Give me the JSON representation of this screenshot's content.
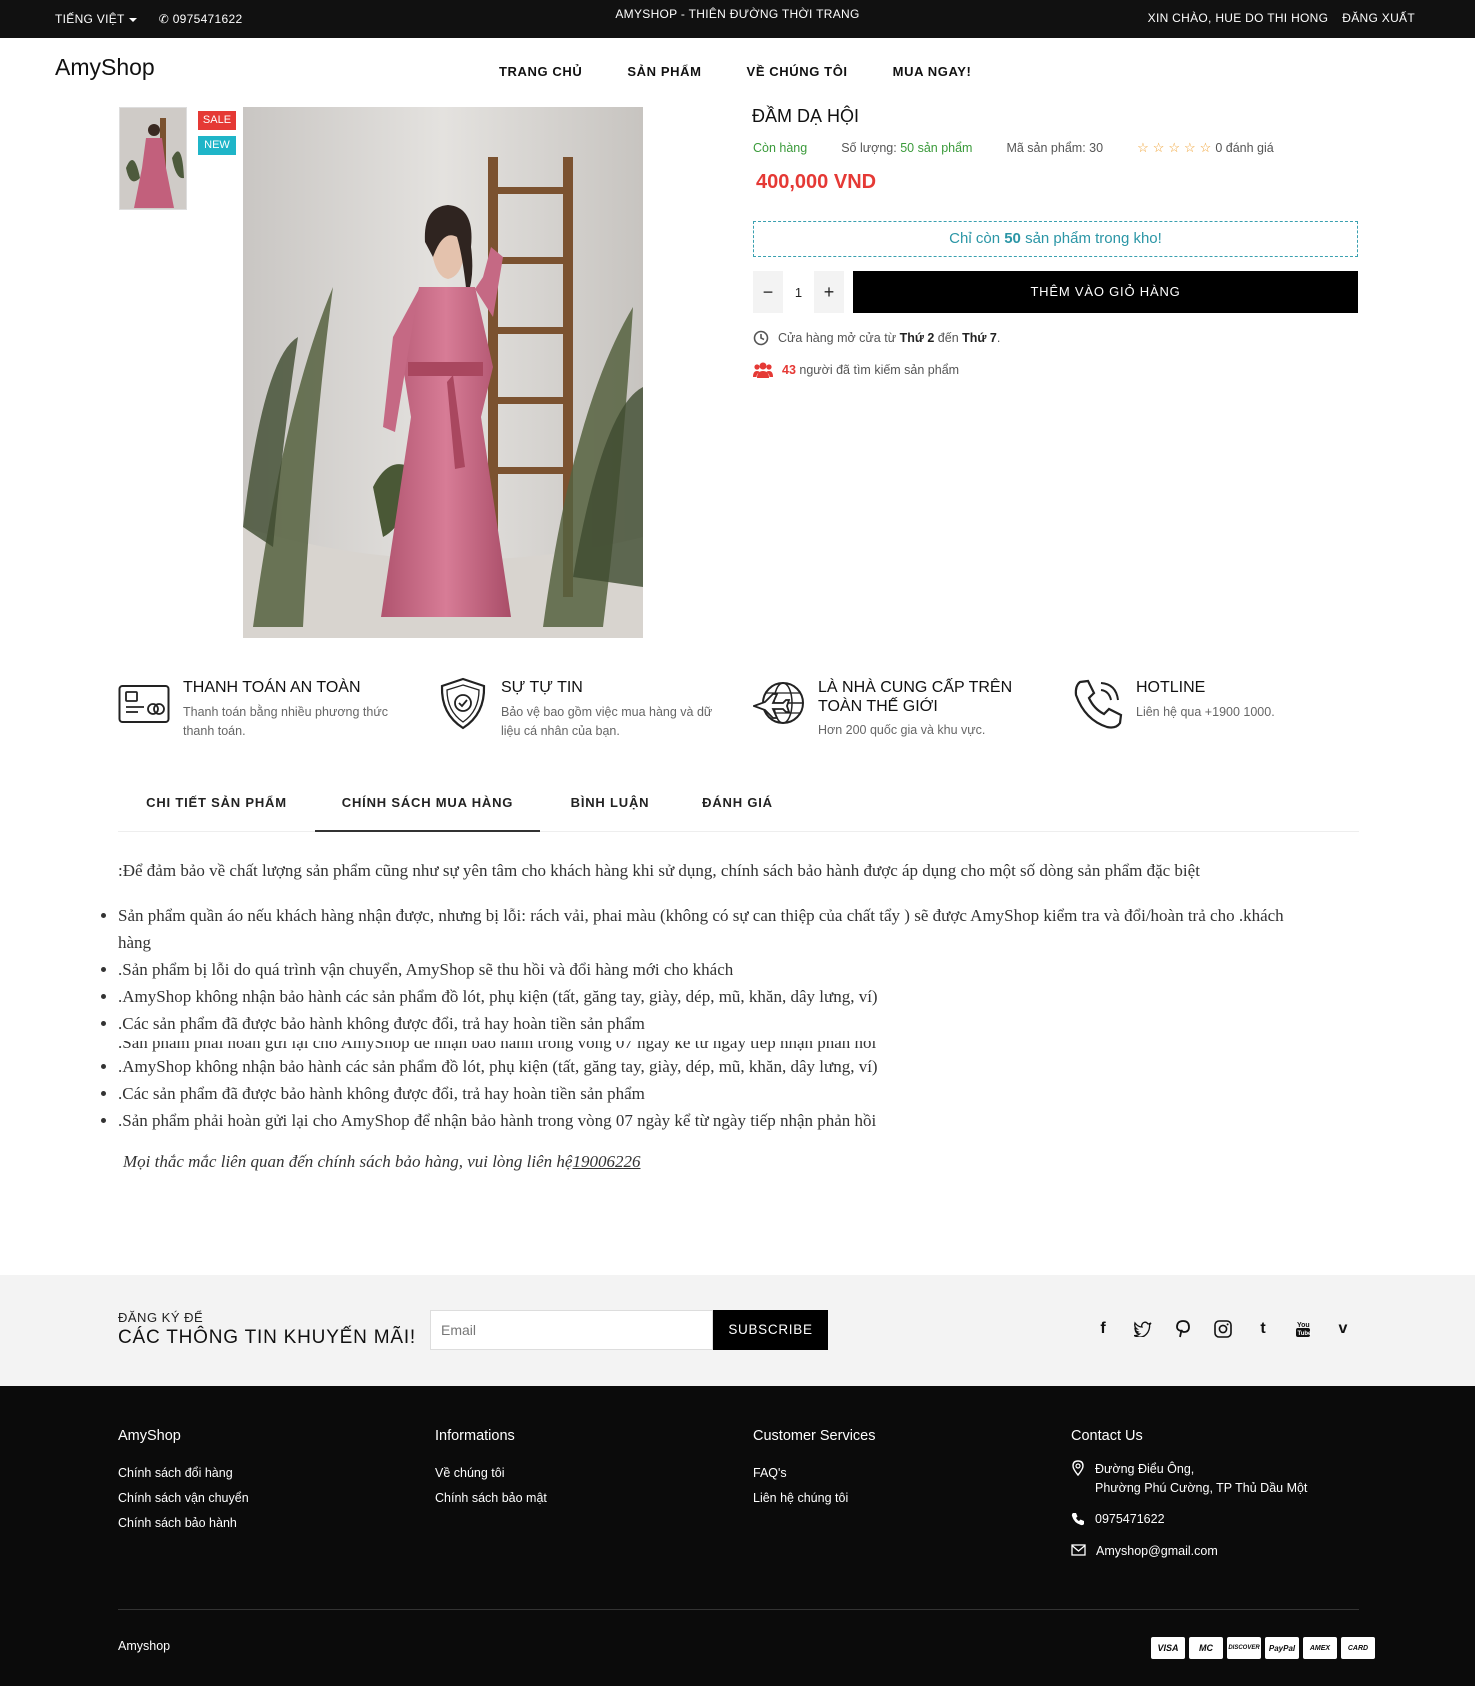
{
  "topbar": {
    "language": "TIẾNG VIỆT",
    "phone": "0975471622",
    "tagline": "AMYSHOP - THIÊN ĐƯỜNG THỜI TRANG",
    "greeting": "XIN CHÀO, HUE DO THI HONG",
    "logout": "ĐĂNG XUẤT"
  },
  "header": {
    "logo": "AmyShop",
    "nav": [
      "TRANG CHỦ",
      "SẢN PHẨM",
      "VỀ CHÚNG TÔI",
      "MUA NGAY!"
    ]
  },
  "gallery": {
    "badges": [
      "SALE",
      "NEW"
    ]
  },
  "product": {
    "title": "ĐẦM DẠ HỘI",
    "status": "Còn hàng",
    "quantity_label": "Số lượng:",
    "quantity_value": "50 sản phẩm",
    "code": "Mã sản phẩm: 30",
    "rating_text": "0 đánh giá",
    "rating_stars": 0,
    "price": "400,000 VND",
    "stock_pre": "Chỉ còn",
    "stock_num": "50",
    "stock_post": "sản phẩm trong kho!",
    "qty_minus": "−",
    "qty_value": "1",
    "qty_plus": "+",
    "add_to_cart": "THÊM VÀO GIỎ HÀNG",
    "hours_pre": "Cửa hàng mở cửa từ",
    "hours_from": "Thứ 2",
    "hours_mid": "đến",
    "hours_to": "Thứ 7",
    "hours_end": ".",
    "viewers_num": "43",
    "viewers_text": "người đã tìm kiếm sản phẩm"
  },
  "features": [
    {
      "title": "THANH TOÁN AN TOÀN",
      "desc": "Thanh toán bằng nhiều phương thức thanh toán.",
      "icon": "credit-card-icon"
    },
    {
      "title": "SỰ TỰ TIN",
      "desc": "Bảo vệ bao gồm việc mua hàng và dữ liệu cá nhân của bạn.",
      "icon": "shield-check-icon"
    },
    {
      "title": "LÀ NHÀ CUNG CẤP TRÊN TOÀN THẾ GIỚI",
      "desc": "Hơn 200 quốc gia và khu vực.",
      "icon": "plane-globe-icon"
    },
    {
      "title": "HOTLINE",
      "desc": "Liên hệ qua +1900 1000.",
      "icon": "phone-icon"
    }
  ],
  "tabs": [
    "CHI TIẾT SẢN PHẨM",
    "CHÍNH SÁCH MUA HÀNG",
    "BÌNH LUẬN",
    "ĐÁNH GIÁ"
  ],
  "active_tab": "CHÍNH SÁCH MUA HÀNG",
  "policy": {
    "intro": ":Để đảm bảo về chất lượng sản phẩm cũng như sự yên tâm cho khách hàng khi sử dụng, chính sách bảo hành được áp dụng cho một số dòng sản phẩm đặc biệt",
    "list1": [
      "Sản phẩm quần áo nếu khách hàng nhận được, nhưng bị lỗi: rách vải, phai màu (không có sự can thiệp của chất tẩy ) sẽ được AmyShop kiểm tra và đổi/hoàn trả cho .khách hàng",
      ".Sản phẩm bị lỗi do quá trình vận chuyển, AmyShop sẽ thu hồi và đổi hàng mới cho khách",
      ".AmyShop không nhận bảo hành các sản phẩm đồ lót, phụ kiện (tất, găng tay, giày, dép, mũ, khăn, dây lưng, ví)",
      ".Các sản phẩm đã được bảo hành không được đổi, trả hay hoàn tiền sản phẩm"
    ],
    "cut_line": ".Sản phẩm phải hoàn gửi lại cho AmyShop để nhận bảo hành trong vòng 07 ngày kể từ ngày tiếp nhận phản hồi",
    "list2": [
      ".AmyShop không nhận bảo hành các sản phẩm đồ lót, phụ kiện (tất, găng tay, giày, dép, mũ, khăn, dây lưng, ví)",
      ".Các sản phẩm đã được bảo hành không được đổi, trả hay hoàn tiền sản phẩm",
      ".Sản phẩm phải hoàn gửi lại cho AmyShop để nhận bảo hành trong vòng 07 ngày kể từ ngày tiếp nhận phản hồi"
    ],
    "closing": "Mọi thắc mắc liên quan đến chính sách bảo hàng, vui lòng liên hệ",
    "hotline": "19006226"
  },
  "subscribe": {
    "line1": "ĐĂNG KÝ ĐỂ",
    "line2": "CÁC THÔNG TIN KHUYẾN MÃI!",
    "placeholder": "Email",
    "button": "SUBSCRIBE",
    "socials": [
      "facebook-icon",
      "twitter-icon",
      "pinterest-icon",
      "instagram-icon",
      "tumblr-icon",
      "youtube-icon",
      "vimeo-icon"
    ]
  },
  "footer": {
    "col1": {
      "title": "AmyShop",
      "links": [
        "Chính sách đổi hàng",
        "Chính sách vận chuyển",
        "Chính sách bảo hành"
      ]
    },
    "col2": {
      "title": "Informations",
      "links": [
        "Về chúng tôi",
        "Chính sách bảo mật"
      ]
    },
    "col3": {
      "title": "Customer Services",
      "links": [
        "FAQ's",
        "Liên hệ chúng tôi"
      ]
    },
    "col4": {
      "title": "Contact Us",
      "address1": "Đường Điểu Ông,",
      "address2": "Phường Phú Cường, TP Thủ Dầu Một",
      "phone": "0975471622",
      "email": "Amyshop@gmail.com"
    },
    "copyright": "Amyshop",
    "payments": [
      "VISA",
      "MC",
      "DISCOVER",
      "PayPal",
      "AMEX",
      "CARD"
    ]
  }
}
